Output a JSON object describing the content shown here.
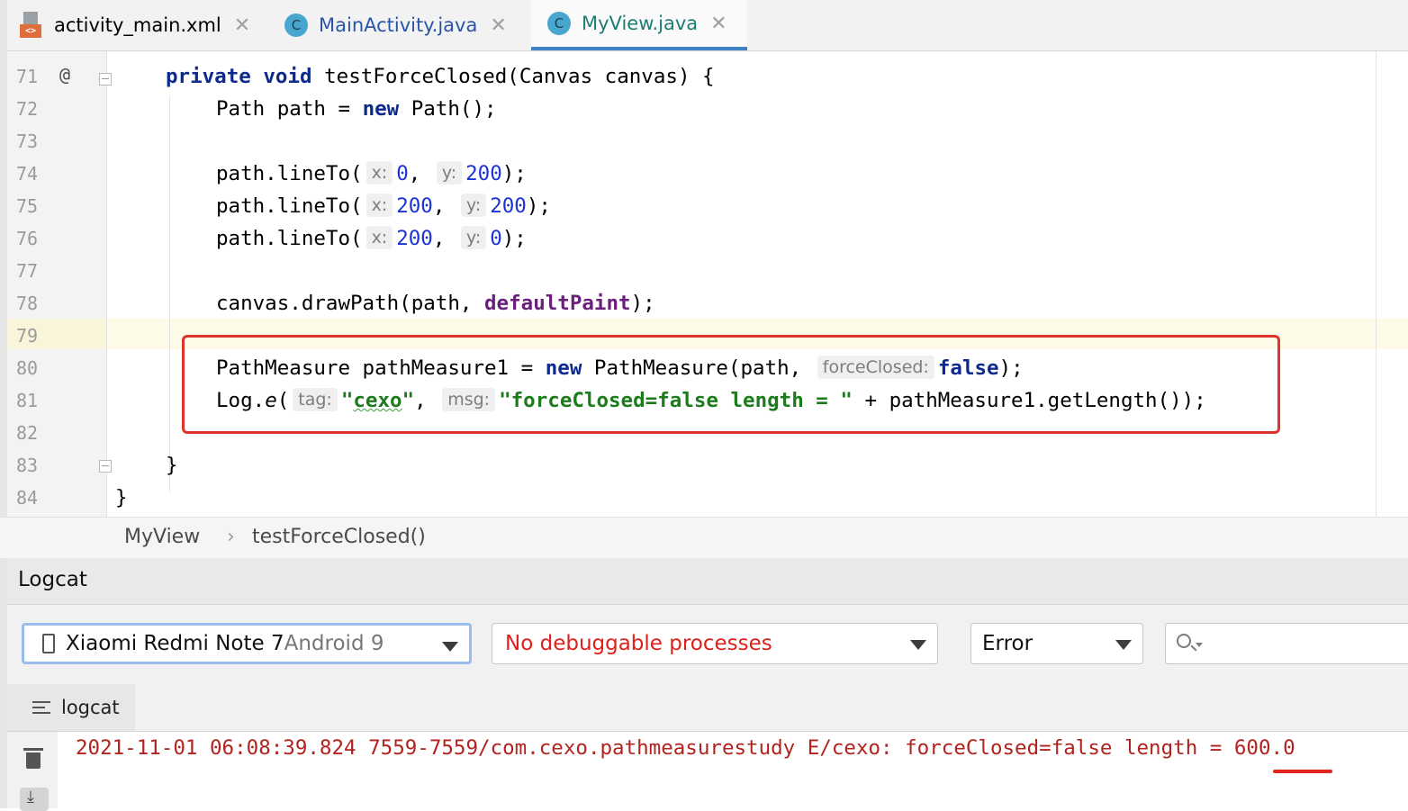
{
  "tabs": [
    {
      "label": "activity_main.xml",
      "icon": "xml-layout-icon",
      "active": false
    },
    {
      "label": "MainActivity.java",
      "icon": "java-class-icon",
      "active": false
    },
    {
      "label": "MyView.java",
      "icon": "java-class-icon",
      "active": true
    }
  ],
  "tab_close_glyph": "✕",
  "class_icon_letter": "C",
  "xml_icon_text": "<>",
  "editor": {
    "gutter_marker": "@",
    "line_numbers": [
      "71",
      "72",
      "73",
      "74",
      "75",
      "76",
      "77",
      "78",
      "79",
      "80",
      "81",
      "82",
      "83",
      "84"
    ],
    "current_line": "79",
    "lines": {
      "l71_kw1": "private",
      "l71_kw2": "void",
      "l71_rest": " testForceClosed(Canvas canvas) {",
      "l72_a": "Path path = ",
      "l72_kw": "new",
      "l72_b": " Path();",
      "l74_a": "path.lineTo(",
      "l74_hx": "x:",
      "l74_x": "0",
      "l74_sep": ",",
      "l74_hy": "y:",
      "l74_y": "200",
      "l74_end": ");",
      "l75_a": "path.lineTo(",
      "l75_hx": "x:",
      "l75_x": "200",
      "l75_sep": ",",
      "l75_hy": "y:",
      "l75_y": "200",
      "l75_end": ");",
      "l76_a": "path.lineTo(",
      "l76_hx": "x:",
      "l76_x": "200",
      "l76_sep": ",",
      "l76_hy": "y:",
      "l76_y": "0",
      "l76_end": ");",
      "l78_a": "canvas.drawPath(path, ",
      "l78_field": "defaultPaint",
      "l78_end": ");",
      "l80_a": "PathMeasure pathMeasure1 = ",
      "l80_kw": "new",
      "l80_b": " PathMeasure(path,",
      "l80_hint": "forceClosed:",
      "l80_kw2": "false",
      "l80_end": ");",
      "l81_a": "Log.",
      "l81_method": "e",
      "l81_paren": "(",
      "l81_htag": "tag:",
      "l81_q1": "\"",
      "l81_tag": "cexo",
      "l81_q2": "\"",
      "l81_sep": ",",
      "l81_hmsg": "msg:",
      "l81_msg": "\"forceClosed=false length = \"",
      "l81_end": " + pathMeasure1.getLength());",
      "l83": "}",
      "l84": "}"
    }
  },
  "breadcrumb": {
    "class_name": "MyView",
    "separator": "›",
    "method_name": "testForceClosed()"
  },
  "logcat": {
    "title": "Logcat",
    "device_name": "Xiaomi Redmi Note 7",
    "device_os": " Android 9",
    "process": "No debuggable processes",
    "level": "Error",
    "search_placeholder": "",
    "subtab_label": "logcat",
    "log_prefix": "2021-11-01 06:08:39.824 7559-7559/com.cexo.pathmeasurestudy E/cexo: forceClosed=false length = ",
    "log_value": "600.0"
  },
  "colors": {
    "keyword": "#0e2a8f",
    "number": "#1b34d4",
    "string": "#1c7c1c",
    "field": "#6a1f7c",
    "error_log": "#b0231f",
    "highlight_box": "#e0332e",
    "process_text": "#e0201a"
  }
}
